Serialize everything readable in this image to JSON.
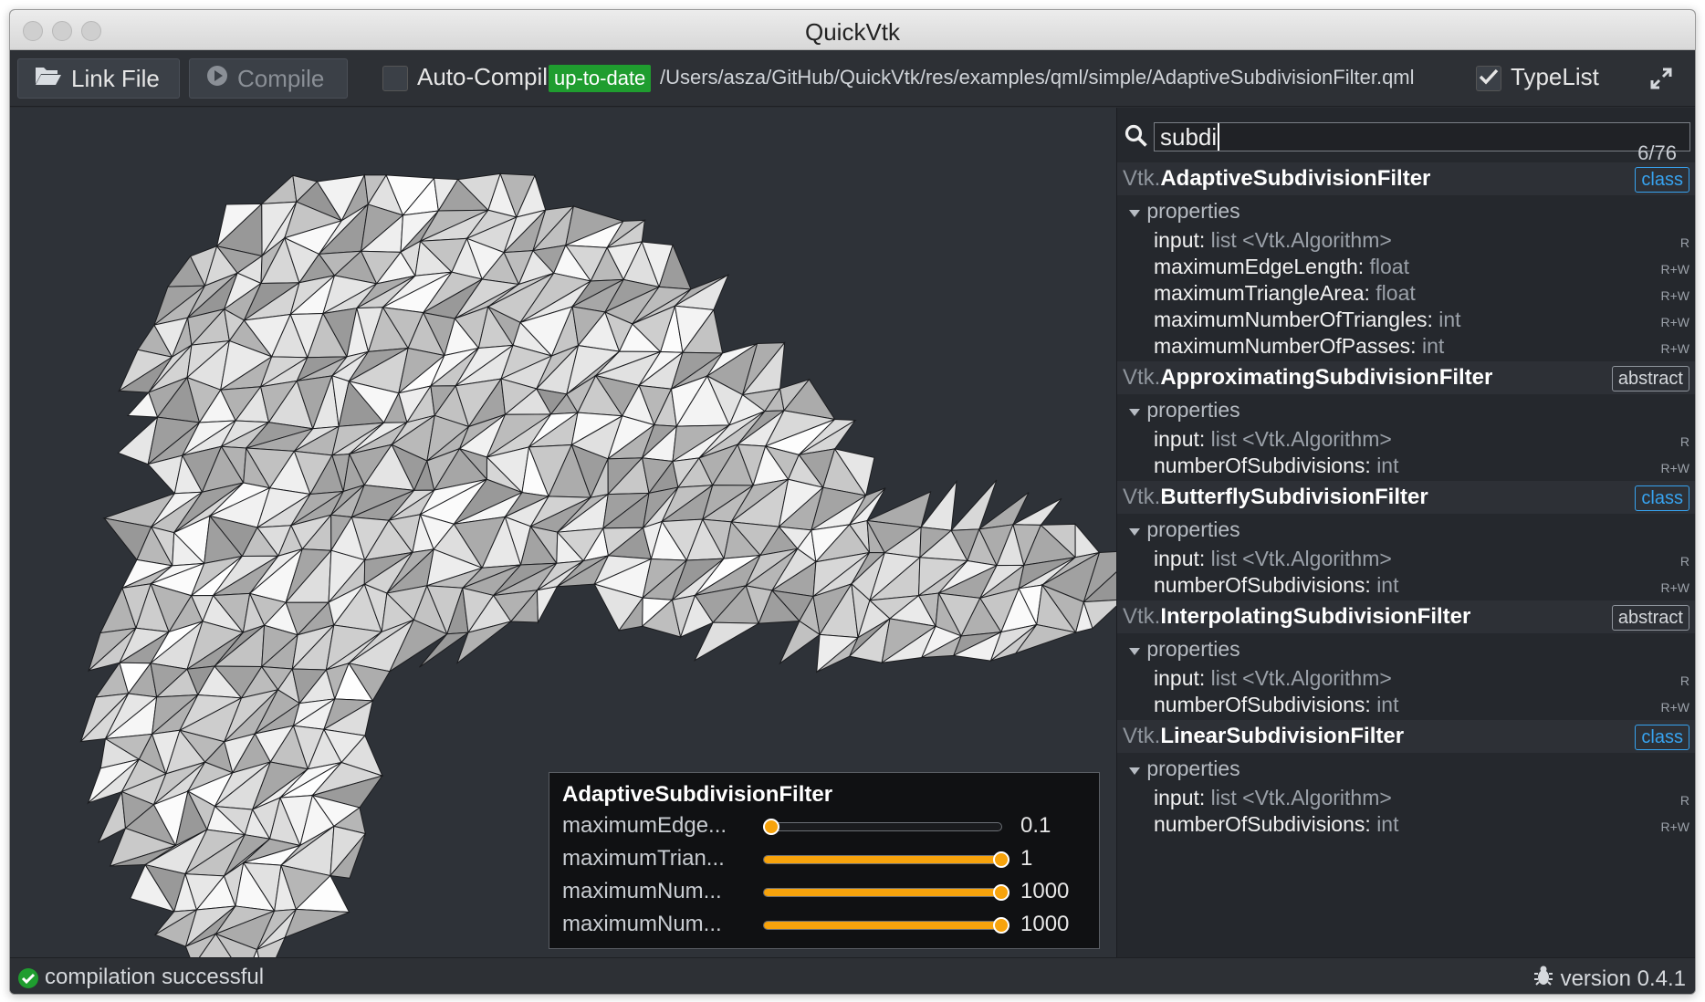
{
  "window": {
    "title": "QuickVtk"
  },
  "toolbar": {
    "link_file_label": "Link File",
    "compile_label": "Compile",
    "auto_compile_label": "Auto-Compil",
    "status_badge": "up-to-date",
    "file_path": "/Users/asza/GitHub/QuickVtk/res/examples/qml/simple/AdaptiveSubdivisionFilter.qml",
    "typelist_label": "TypeList",
    "typelist_checked": true
  },
  "search": {
    "value": "subdi",
    "count": "6/76"
  },
  "types": [
    {
      "namespace": "Vtk.",
      "name": "AdaptiveSubdivisionFilter",
      "kind": "class",
      "section": "properties",
      "properties": [
        {
          "name": "input:",
          "type": "list <Vtk.Algorithm>",
          "perm": "R"
        },
        {
          "name": "maximumEdgeLength:",
          "type": "float",
          "perm": "R+W"
        },
        {
          "name": "maximumTriangleArea:",
          "type": "float",
          "perm": "R+W"
        },
        {
          "name": "maximumNumberOfTriangles:",
          "type": "int",
          "perm": "R+W"
        },
        {
          "name": "maximumNumberOfPasses:",
          "type": "int",
          "perm": "R+W"
        }
      ]
    },
    {
      "namespace": "Vtk.",
      "name": "ApproximatingSubdivisionFilter",
      "kind": "abstract",
      "section": "properties",
      "properties": [
        {
          "name": "input:",
          "type": "list <Vtk.Algorithm>",
          "perm": "R"
        },
        {
          "name": "numberOfSubdivisions:",
          "type": "int",
          "perm": "R+W"
        }
      ]
    },
    {
      "namespace": "Vtk.",
      "name": "ButterflySubdivisionFilter",
      "kind": "class",
      "section": "properties",
      "properties": [
        {
          "name": "input:",
          "type": "list <Vtk.Algorithm>",
          "perm": "R"
        },
        {
          "name": "numberOfSubdivisions:",
          "type": "int",
          "perm": "R+W"
        }
      ]
    },
    {
      "namespace": "Vtk.",
      "name": "InterpolatingSubdivisionFilter",
      "kind": "abstract",
      "section": "properties",
      "properties": [
        {
          "name": "input:",
          "type": "list <Vtk.Algorithm>",
          "perm": "R"
        },
        {
          "name": "numberOfSubdivisions:",
          "type": "int",
          "perm": "R+W"
        }
      ]
    },
    {
      "namespace": "Vtk.",
      "name": "LinearSubdivisionFilter",
      "kind": "class",
      "section": "properties",
      "properties": [
        {
          "name": "input:",
          "type": "list <Vtk.Algorithm>",
          "perm": "R"
        },
        {
          "name": "numberOfSubdivisions:",
          "type": "int",
          "perm": "R+W"
        }
      ]
    }
  ],
  "panel": {
    "title": "AdaptiveSubdivisionFilter",
    "sliders": [
      {
        "label": "maximumEdge...",
        "value": "0.1",
        "fraction": 0.03
      },
      {
        "label": "maximumTrian...",
        "value": "1",
        "fraction": 1.0
      },
      {
        "label": "maximumNum...",
        "value": "1000",
        "fraction": 1.0
      },
      {
        "label": "maximumNum...",
        "value": "1000",
        "fraction": 1.0
      }
    ]
  },
  "status": {
    "message": "compilation successful",
    "version": "version 0.4.1"
  },
  "colors": {
    "accent": "#f7a30c",
    "success": "#1f9d2f",
    "class_badge": "#37a3f0"
  }
}
